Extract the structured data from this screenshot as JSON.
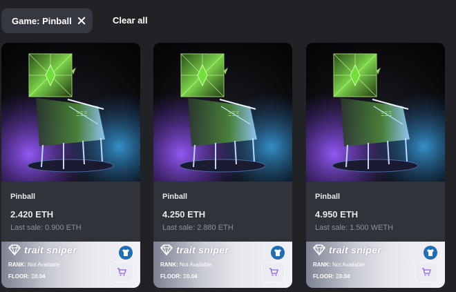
{
  "filters": {
    "chip_label": "Game: Pinball",
    "clear_all_label": "Clear all"
  },
  "cards": [
    {
      "name": "Pinball",
      "price": "2.420 ETH",
      "last_sale": "Last sale: 0.900 ETH",
      "trait_sniper": {
        "title": "trait sniper",
        "rank_label": "RANK:",
        "rank_value": "Not Available",
        "floor_label": "FLOOR:",
        "floor_value": "Ξ0.04"
      }
    },
    {
      "name": "Pinball",
      "price": "4.250 ETH",
      "last_sale": "Last sale: 2.880 ETH",
      "trait_sniper": {
        "title": "trait sniper",
        "rank_label": "RANK:",
        "rank_value": "Not Available",
        "floor_label": "FLOOR:",
        "floor_value": "Ξ0.04"
      }
    },
    {
      "name": "Pinball",
      "price": "4.950 ETH",
      "last_sale": "Last sale: 1.500 WETH",
      "trait_sniper": {
        "title": "trait sniper",
        "rank_label": "RANK:",
        "rank_value": "Not Available",
        "floor_label": "FLOOR:",
        "floor_value": "Ξ0.04"
      }
    }
  ],
  "icons": {
    "chip_close": "close-icon",
    "trait_logo": "diamond-icon",
    "trait_badge": "shirt-icon",
    "cart": "cart-icon"
  },
  "colors": {
    "background": "#202225",
    "card": "#303339",
    "chip": "#353840",
    "badge_blue": "#1f6fb8",
    "cart_purple": "#8a5cf6"
  }
}
